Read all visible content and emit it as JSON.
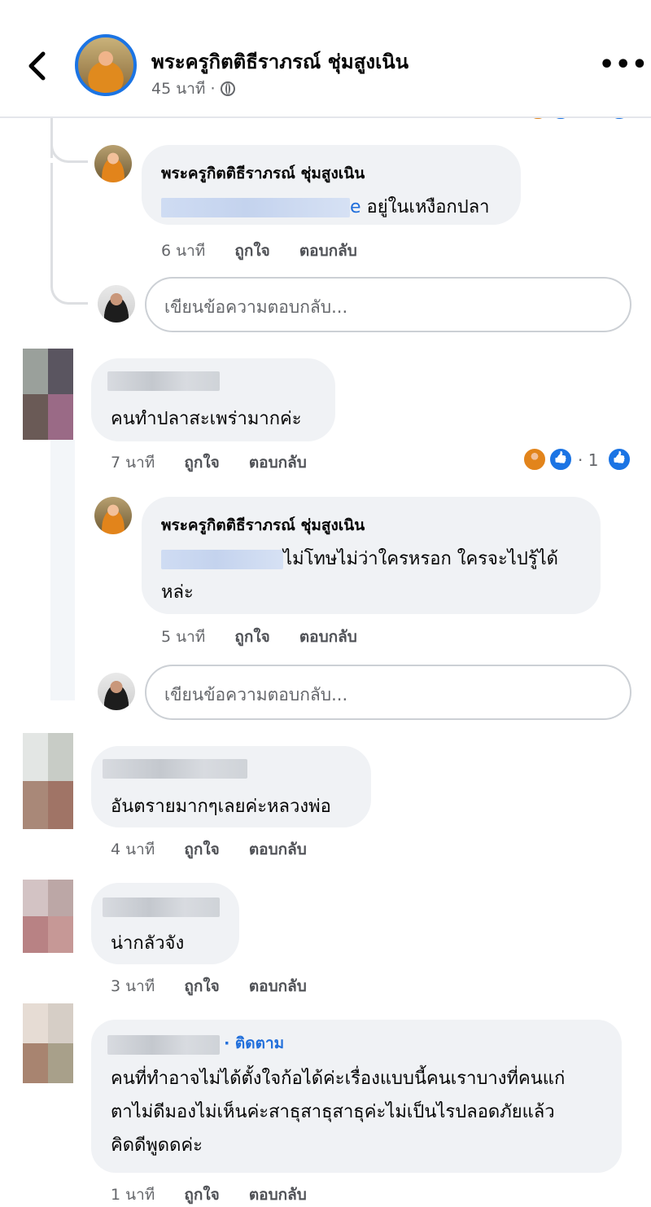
{
  "header": {
    "page_name": "พระครูกิตติธีราภรณ์ ชุ่มสูงเนิน",
    "time": "45 นาที ·"
  },
  "actions": {
    "like": "ถูกใจ",
    "reply": "ตอบกลับ"
  },
  "reply_input_placeholder": "เขียนข้อความตอบกลับ...",
  "thread": [
    {
      "id": "reply1",
      "author": "พระครูกิตติธีราภรณ์ ชุ่มสูงเนิน",
      "mention_visible_end": "e",
      "text": "อยู่ในเหงือกปลา",
      "time": "6 นาที"
    },
    {
      "id": "comment1",
      "text": "คนทำปลาสะเพร่ามากค่ะ",
      "time": "7 นาที",
      "reaction_count": "· 1"
    },
    {
      "id": "reply2",
      "author": "พระครูกิตติธีราภรณ์ ชุ่มสูงเนิน",
      "text_line1": "ไม่โทษไม่ว่าใครหรอก ใครจะไปรู้ได้",
      "text_line2": "หล่ะ",
      "time": "5 นาที"
    },
    {
      "id": "comment2",
      "text": "อันตรายมากๆเลยค่ะหลวงพ่อ",
      "time": "4 นาที"
    },
    {
      "id": "comment3",
      "text": "น่ากลัวจัง",
      "time": "3 นาที"
    },
    {
      "id": "comment4",
      "follow": "· ติดตาม",
      "text_line1": "คนที่ทำอาจไม่ได้ตั้งใจก้อได้ค่ะเรื่องแบบนี้คนเราบางที่คนแก่",
      "text_line2": "ตาไม่ดีมองไม่เห็นค่ะสาธุสาธุสาธุค่ะไม่เป็นไรปลอดภัยแล้ว",
      "text_line3": "คิดดีพูดดค่ะ",
      "time": "1 นาที"
    }
  ],
  "colors": {
    "accent": "#1b74e4",
    "bubble": "#f0f2f5",
    "meta": "#65676b"
  }
}
